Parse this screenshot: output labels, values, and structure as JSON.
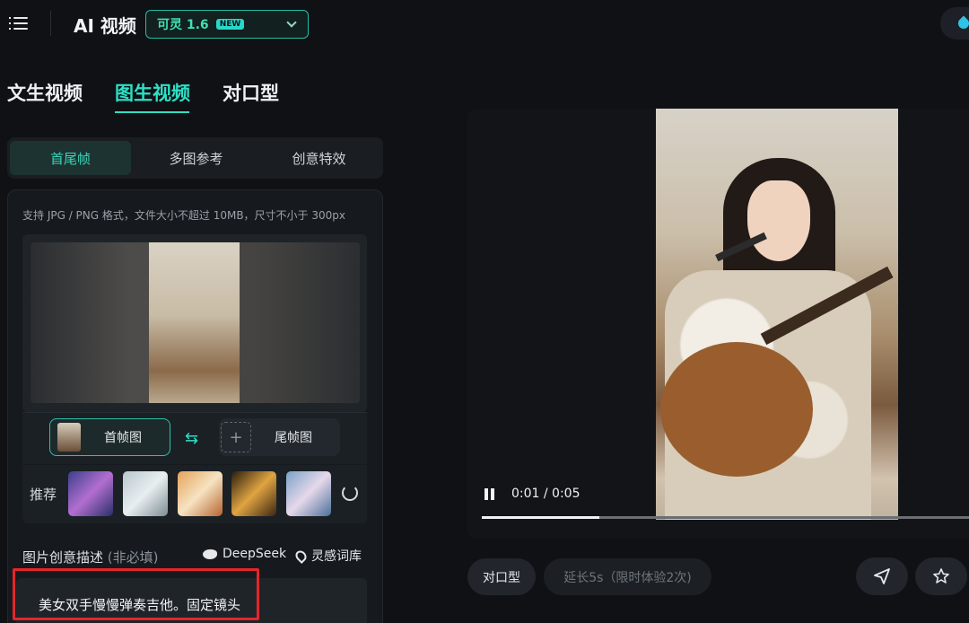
{
  "header": {
    "app_title": "AI 视频",
    "model": {
      "label": "可灵 1.6",
      "badge": "NEW"
    }
  },
  "main_tabs": [
    {
      "label": "文生视频",
      "active": false
    },
    {
      "label": "图生视频",
      "active": true
    },
    {
      "label": "对口型",
      "active": false
    }
  ],
  "sub_tabs": [
    {
      "label": "首尾帧",
      "active": true
    },
    {
      "label": "多图参考",
      "active": false
    },
    {
      "label": "创意特效",
      "active": false
    }
  ],
  "upload": {
    "hint": "支持 JPG / PNG 格式，文件大小不超过 10MB，尺寸不小于 300px",
    "first_frame_label": "首帧图",
    "last_frame_label": "尾帧图",
    "add_symbol": "+",
    "swap_symbol": "⇆"
  },
  "recommend": {
    "label": "推荐"
  },
  "description": {
    "label": "图片创意描述",
    "optional": "(非必填)",
    "deepseek_label": "DeepSeek",
    "inspiration_label": "灵感词库",
    "prompt": "美女双手慢慢弹奏吉他。固定镜头"
  },
  "player": {
    "timecode": "0:01 / 0:05",
    "progress": 0.24
  },
  "actions": {
    "lipsync_label": "对口型",
    "extend_label": "延长5s（限时体验2次)"
  },
  "colors": {
    "accent": "#2ee0c6",
    "highlight_outline": "#e3262b"
  }
}
